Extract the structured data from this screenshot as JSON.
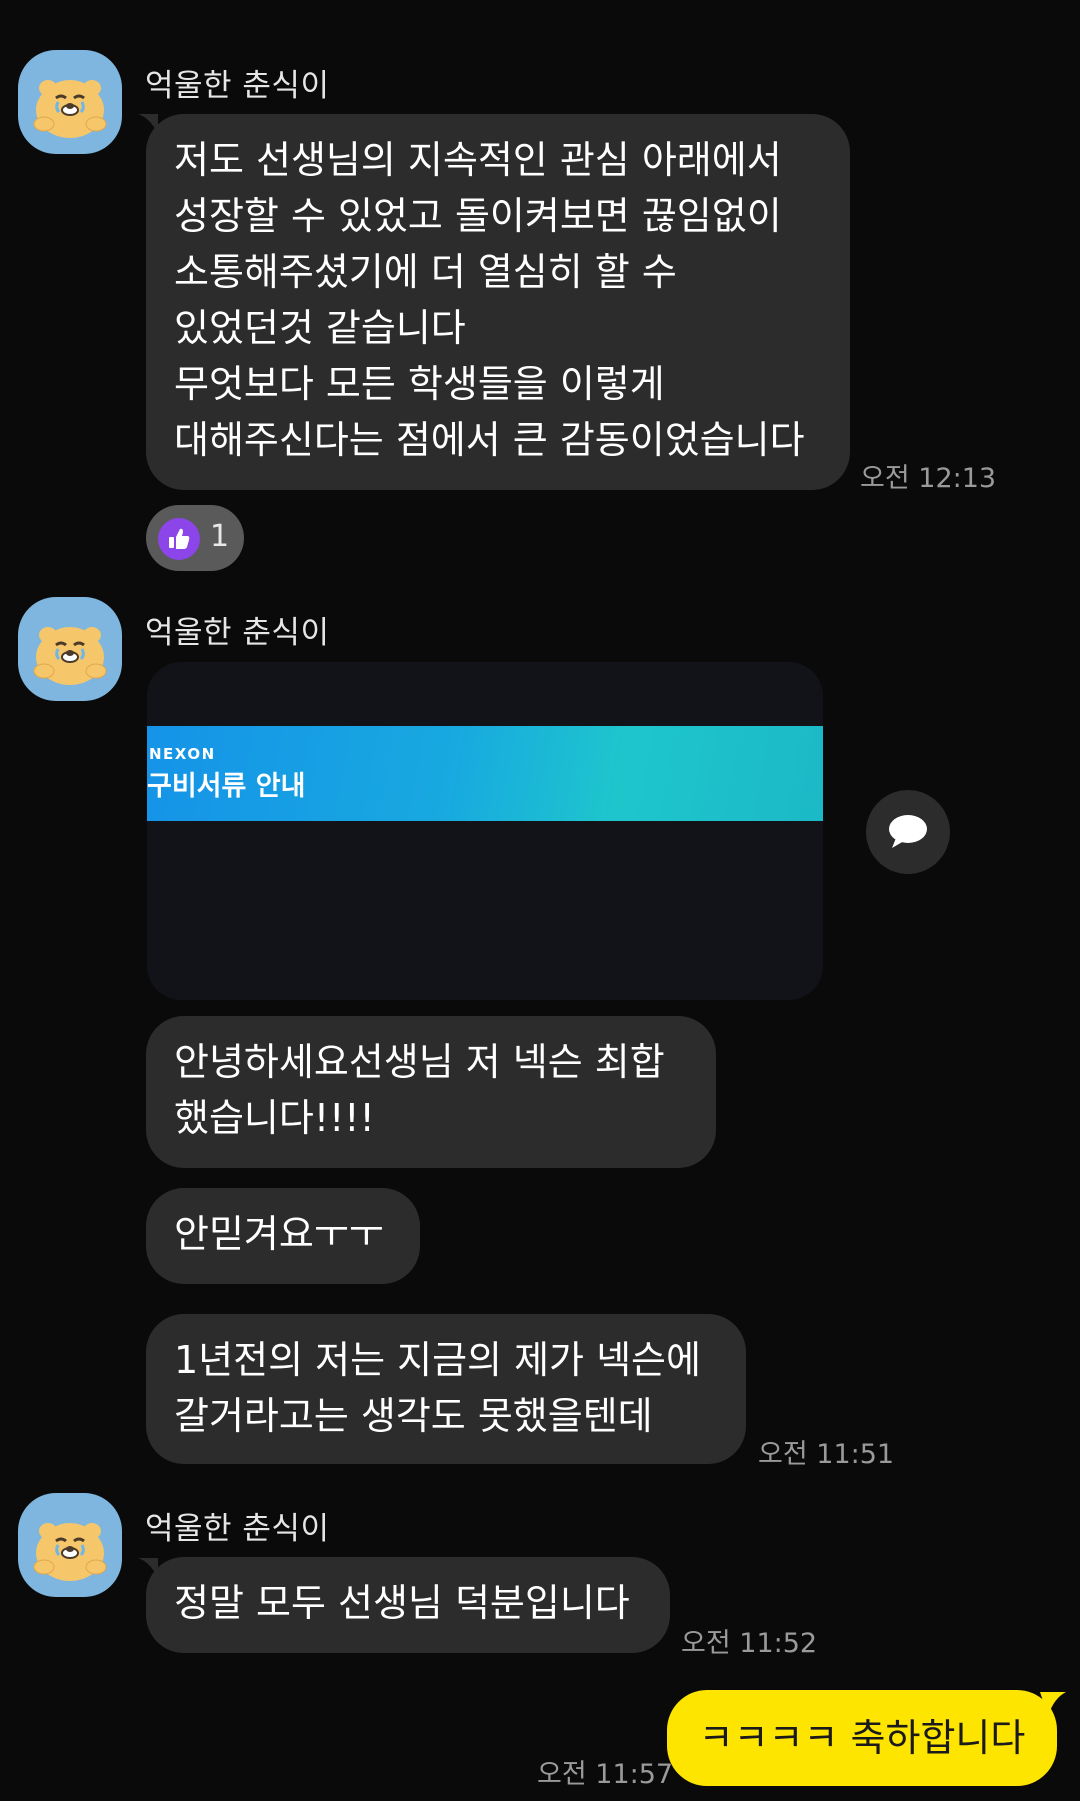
{
  "sender_name": "억울한 춘식이",
  "messages": {
    "m1": {
      "lines": [
        "저도 선생님의 지속적인 관심 아래에서",
        "성장할 수 있었고 돌이켜보면 끊임없이",
        "소통해주셨기에 더 열심히 할 수",
        "있었던것 같습니다",
        "무엇보다 모든 학생들을 이렇게",
        "대해주신다는 점에서 큰 감동이었습니다"
      ],
      "time": "오전 12:13",
      "reaction_count": "1",
      "reaction_icon": "thumbs-up-icon",
      "reaction_color": "#8b45e8"
    },
    "m2": {
      "image": {
        "brand": "NEXON",
        "headline": "구비서류 안내"
      }
    },
    "m3": {
      "lines": [
        "안녕하세요선생님 저 넥슨 최합",
        "했습니다!!!!"
      ]
    },
    "m4": {
      "lines": [
        "안믿겨요ㅜㅜ"
      ]
    },
    "m5": {
      "lines": [
        "1년전의 저는 지금의 제가 넥슨에",
        "갈거라고는 생각도 못했을텐데"
      ],
      "time": "오전 11:51"
    },
    "m6": {
      "lines": [
        "정말 모두 선생님 덕분입니다"
      ],
      "time": "오전 11:52"
    },
    "mine": {
      "text": "ㅋㅋㅋㅋ 축하합니다",
      "time": "오전 11:57"
    }
  },
  "colors": {
    "background": "#0a0a0a",
    "received_bubble": "#2c2c2c",
    "sent_bubble": "#fee500",
    "avatar_bg": "#7fb6df"
  }
}
